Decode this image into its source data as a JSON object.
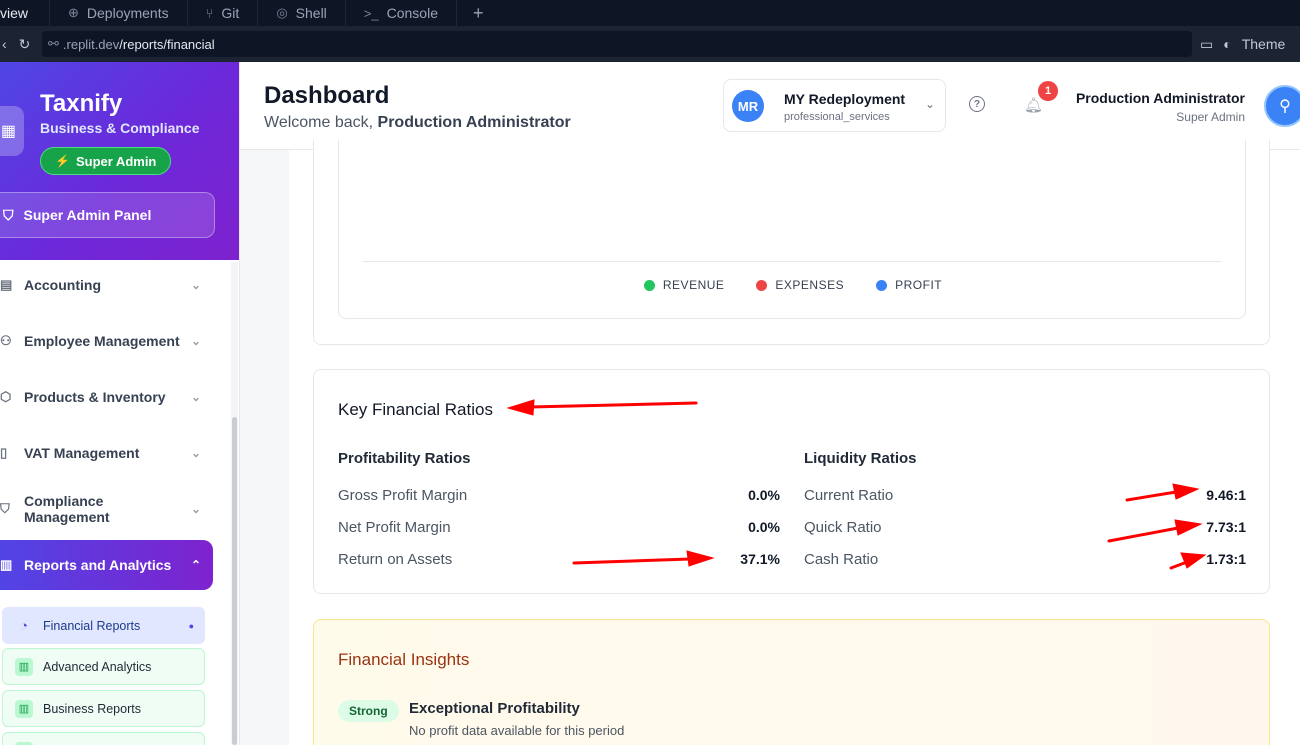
{
  "browser": {
    "tabs": [
      {
        "label": "view",
        "icon": ""
      },
      {
        "label": "Deployments",
        "icon": "deploy-icon"
      },
      {
        "label": "Git",
        "icon": "git-icon"
      },
      {
        "label": "Shell",
        "icon": "shell-icon"
      },
      {
        "label": "Console",
        "icon": "console-icon"
      }
    ],
    "new_tab": "+",
    "url_host": ".replit.dev",
    "url_path": "/reports/financial",
    "theme_label": "Theme"
  },
  "sidebar": {
    "brand": "Taxnify",
    "brand_subtitle": "Business & Compliance",
    "role_badge": "Super Admin",
    "admin_panel": "Super Admin Panel",
    "nav": [
      {
        "label": "Accounting",
        "icon": "calculator-icon"
      },
      {
        "label": "Employee Management",
        "icon": "users-icon"
      },
      {
        "label": "Products & Inventory",
        "icon": "box-icon"
      },
      {
        "label": "VAT Management",
        "icon": "receipt-icon"
      },
      {
        "label": "Compliance Management",
        "icon": "shield-icon"
      },
      {
        "label": "Reports and Analytics",
        "icon": "chart-icon"
      }
    ],
    "sub_items": [
      {
        "label": "Financial Reports",
        "icon": "pie-chart-icon"
      },
      {
        "label": "Advanced Analytics",
        "icon": "bar-chart-icon"
      },
      {
        "label": "Business Reports",
        "icon": "bar-chart-icon"
      }
    ]
  },
  "header": {
    "title": "Dashboard",
    "welcome_prefix": "Welcome back,",
    "welcome_name": "Production Administrator",
    "org_initials": "MR",
    "org_name": "MY Redeployment",
    "org_type": "professional_services",
    "notification_count": "1",
    "user_name": "Production Administrator",
    "user_role": "Super Admin"
  },
  "chart_legend": [
    {
      "label": "REVENUE",
      "color": "#22c55e"
    },
    {
      "label": "EXPENSES",
      "color": "#ef4444"
    },
    {
      "label": "PROFIT",
      "color": "#3b82f6"
    }
  ],
  "ratios": {
    "title": "Key Financial Ratios",
    "profitability": {
      "title": "Profitability Ratios",
      "rows": [
        {
          "label": "Gross Profit Margin",
          "value": "0.0%"
        },
        {
          "label": "Net Profit Margin",
          "value": "0.0%"
        },
        {
          "label": "Return on Assets",
          "value": "37.1%"
        }
      ]
    },
    "liquidity": {
      "title": "Liquidity Ratios",
      "rows": [
        {
          "label": "Current Ratio",
          "value": "9.46:1"
        },
        {
          "label": "Quick Ratio",
          "value": "7.73:1"
        },
        {
          "label": "Cash Ratio",
          "value": "1.73:1"
        }
      ]
    }
  },
  "insights": {
    "title": "Financial Insights",
    "badge": "Strong",
    "heading": "Exceptional Profitability",
    "text": "No profit data available for this period"
  },
  "colors": {
    "accent": "#4f46e5",
    "annotation": "#ff0000"
  }
}
